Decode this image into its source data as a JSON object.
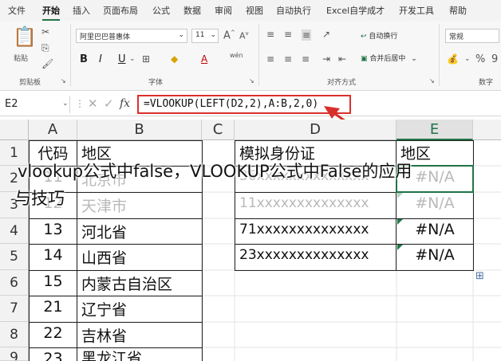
{
  "menu": [
    "文件",
    "开始",
    "插入",
    "页面布局",
    "公式",
    "数据",
    "审阅",
    "视图",
    "自动执行",
    "Excel自学成才",
    "开发工具",
    "帮助"
  ],
  "ribbon": {
    "paste_label": "粘贴",
    "clipboard_label": "剪贴板",
    "font_name": "阿里巴巴普惠体",
    "font_size": "11",
    "font_group_label": "字体",
    "bold": "B",
    "italic": "I",
    "underline": "U",
    "grow_font": "A",
    "shrink_font": "A",
    "wen": "wén",
    "wrap_text": "自动换行",
    "merge_center": "合并后居中",
    "align_group_label": "对齐方式",
    "number_format": "常规",
    "number_group_label": "数字",
    "percent": "%",
    "comma": "9"
  },
  "formula_bar": {
    "name_box": "E2",
    "fx": "fx",
    "formula": "=VLOOKUP(LEFT(D2,2),A:B,2,0)"
  },
  "columns": [
    "A",
    "B",
    "C",
    "D",
    "E"
  ],
  "rows": [
    "1",
    "2",
    "3",
    "4",
    "5",
    "6",
    "7",
    "8",
    "9"
  ],
  "cells": {
    "A1": "代码",
    "B1": "地区",
    "D1": "模拟身份证",
    "E1": "地区",
    "A2": "11",
    "B2": "北京市",
    "D2": "36xxxxxxxxxxxxxx",
    "E2": "#N/A",
    "A3": "12",
    "B3": "天津市",
    "D3": "11xxxxxxxxxxxxxx",
    "E3": "#N/A",
    "A4": "13",
    "B4": "河北省",
    "D4": "71xxxxxxxxxxxxxx",
    "E4": "#N/A",
    "A5": "14",
    "B5": "山西省",
    "D5": "23xxxxxxxxxxxxxx",
    "E5": "#N/A",
    "A6": "15",
    "B6": "内蒙古自治区",
    "A7": "21",
    "B7": "辽宁省",
    "A8": "22",
    "B8": "吉林省",
    "A9": "23",
    "B9": "黑龙江省"
  },
  "caption": {
    "line1": "vlookup公式中false，VLOOKUP公式中False的应用",
    "line2": "与技巧"
  },
  "accent_color": "#217346",
  "highlight_color": "#d9302c"
}
